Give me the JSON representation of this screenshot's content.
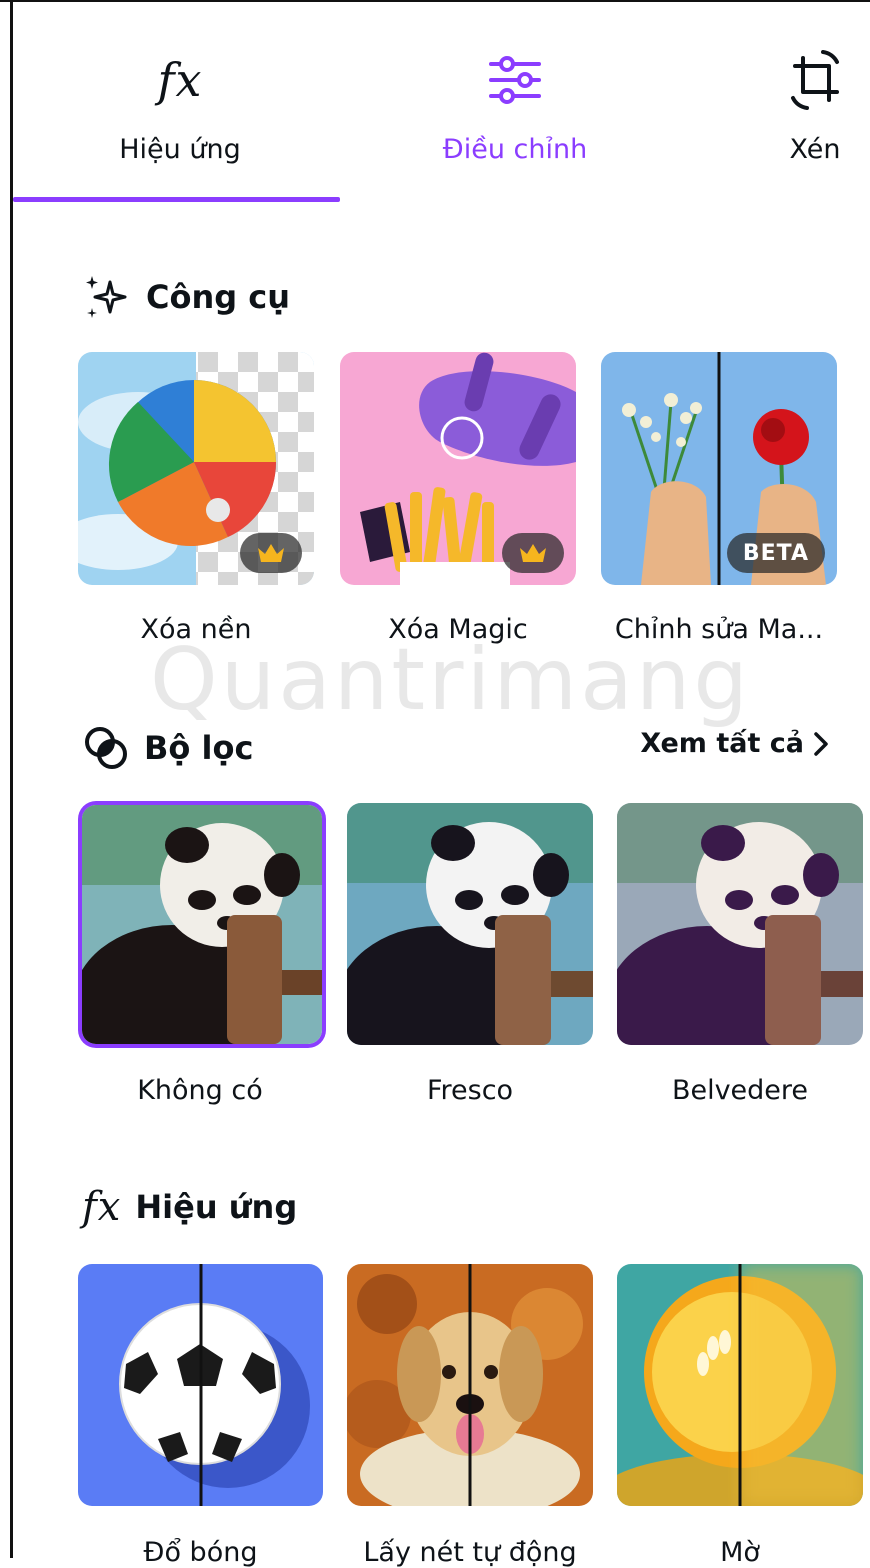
{
  "tabs": [
    {
      "label": "Hiệu ứng",
      "icon": "fx-icon",
      "active": true
    },
    {
      "label": "Điều chỉnh",
      "icon": "sliders-icon",
      "active": false
    },
    {
      "label": "Xén",
      "icon": "crop-icon",
      "active": false
    }
  ],
  "fx_glyph": "fx",
  "tools": {
    "title": "Công cụ",
    "items": [
      {
        "label": "Xóa nền",
        "badge": "crown"
      },
      {
        "label": "Xóa Magic",
        "badge": "crown"
      },
      {
        "label": "Chỉnh sửa Ma...",
        "badge": "BETA"
      }
    ]
  },
  "filters": {
    "title": "Bộ lọc",
    "see_all": "Xem tất cả",
    "items": [
      {
        "label": "Không có",
        "selected": true
      },
      {
        "label": "Fresco",
        "selected": false
      },
      {
        "label": "Belvedere",
        "selected": false
      }
    ]
  },
  "effects": {
    "title": "Hiệu ứng",
    "items": [
      {
        "label": "Đổ bóng"
      },
      {
        "label": "Lấy nét tự động"
      },
      {
        "label": "Mờ"
      }
    ]
  },
  "watermark": "Quantrimang",
  "colors": {
    "accent": "#8b3dff",
    "text": "#0e1318"
  }
}
